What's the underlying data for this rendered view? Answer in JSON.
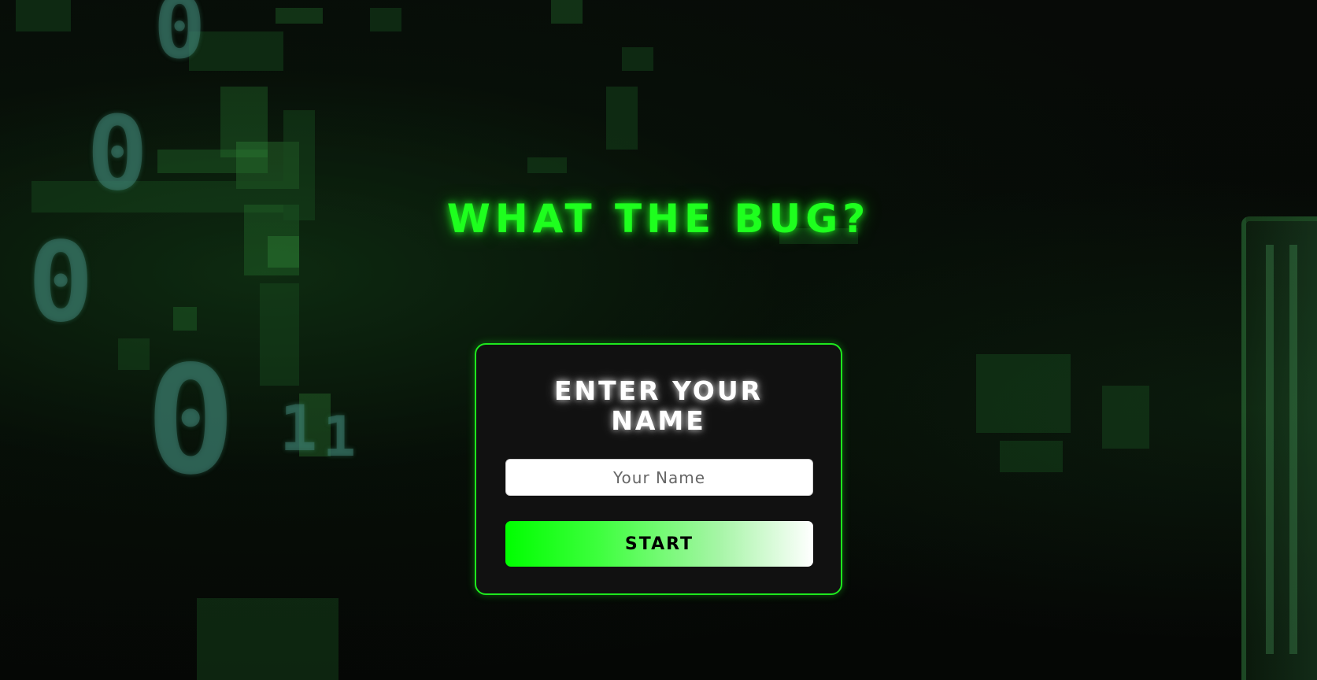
{
  "page": {
    "title": "WHAT THE BUG?",
    "accent_color": "#1eff1e",
    "background": "dark green glitch binary pattern"
  },
  "background_digits": [
    "0",
    "0",
    "0",
    "0",
    "1",
    "1"
  ],
  "form": {
    "heading": "ENTER YOUR NAME",
    "name_input": {
      "placeholder": "Your Name",
      "value": ""
    },
    "start_label": "START"
  }
}
